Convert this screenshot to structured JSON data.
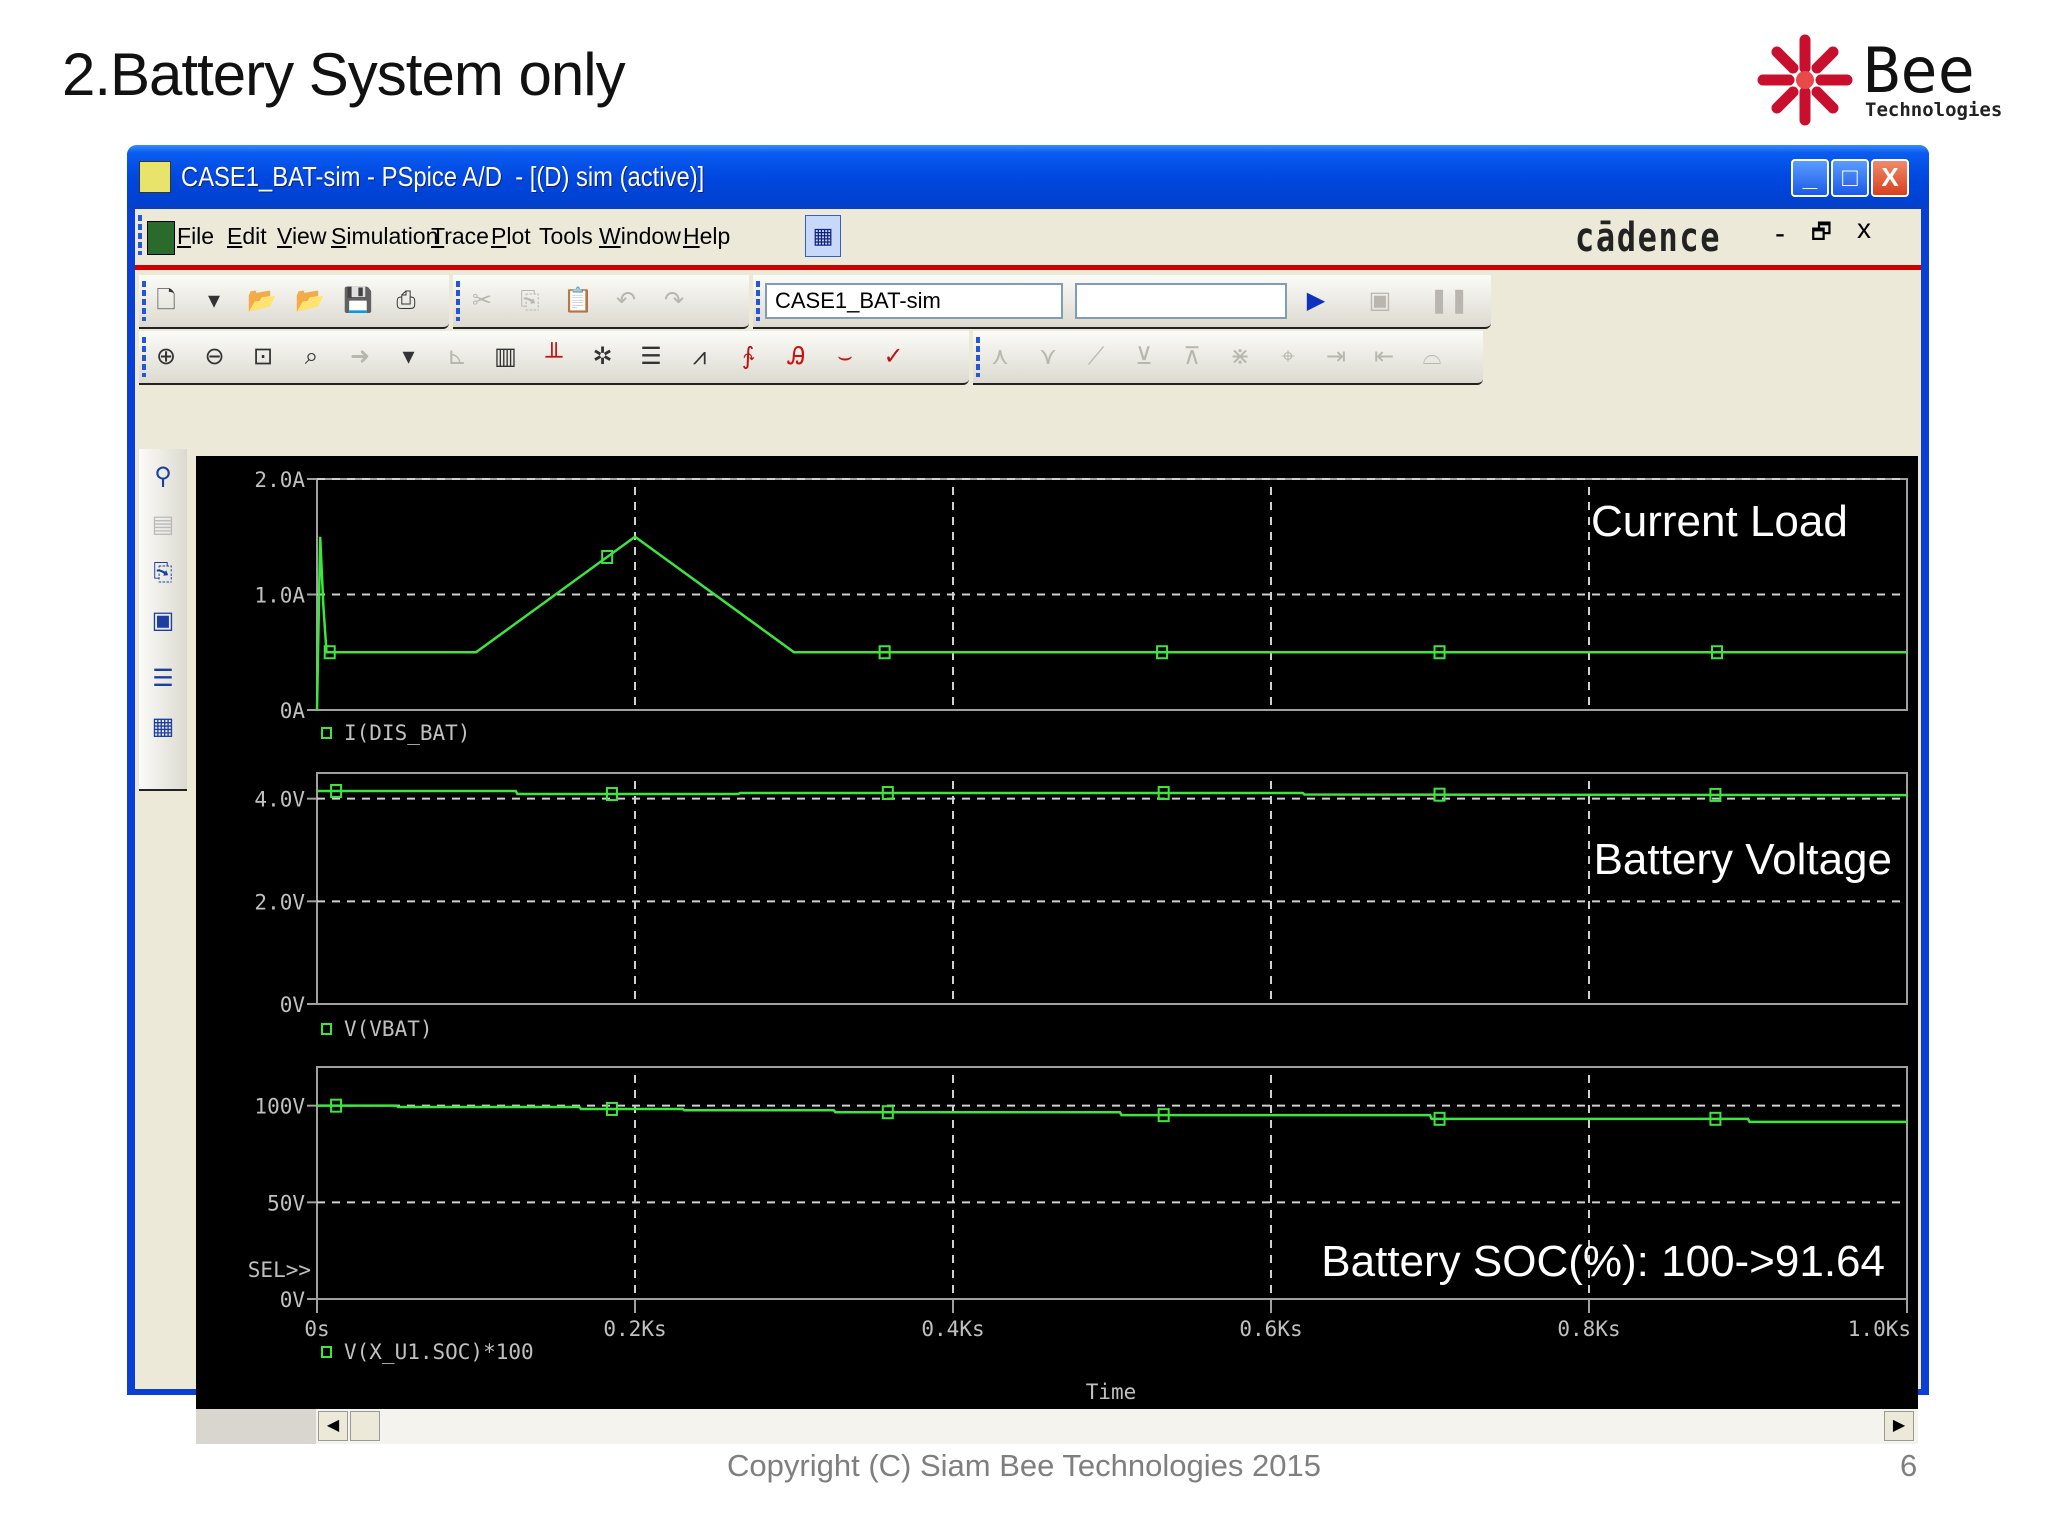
{
  "slide": {
    "title": "2.Battery System only",
    "logo_text": "Bee",
    "logo_subtext": "Technologies",
    "footer": "Copyright (C) Siam Bee Technologies 2015",
    "page_number": "6"
  },
  "window": {
    "title": "CASE1_BAT-sim - PSpice A/D  - [(D) sim (active)]",
    "controls": {
      "minimize": "_",
      "maximize": "□",
      "close": "X"
    },
    "brand": "cādence",
    "mdi_controls": {
      "minimize": "-",
      "restore": "🗗",
      "close": "x"
    }
  },
  "menu": [
    {
      "label": "File",
      "u": "F",
      "rest": "ile"
    },
    {
      "label": "Edit",
      "u": "E",
      "rest": "dit"
    },
    {
      "label": "View",
      "u": "V",
      "rest": "iew"
    },
    {
      "label": "Simulation",
      "u": "S",
      "rest": "imulation"
    },
    {
      "label": "Trace",
      "u": "T",
      "rest": "race"
    },
    {
      "label": "Plot",
      "u": "P",
      "rest": "lot"
    },
    {
      "label": "Tools",
      "u": "T",
      "rest": "ools",
      "pre": "",
      "mid": true
    },
    {
      "label": "Window",
      "u": "W",
      "rest": "indow"
    },
    {
      "label": "Help",
      "u": "H",
      "rest": "elp"
    }
  ],
  "toolbar": {
    "profile_combo": "CASE1_BAT-sim",
    "second_combo": "",
    "row1_icons": [
      "new-icon",
      "dropdown-arrow-icon",
      "open-icon",
      "open-folder-icon",
      "save-icon",
      "print-icon",
      "cut-icon",
      "copy-icon",
      "paste-icon",
      "undo-icon",
      "redo-icon"
    ],
    "row1_right_icons": [
      "run-icon",
      "pause-icon",
      "stop-icon"
    ],
    "row2_icons": [
      "zoom-in-icon",
      "zoom-out-icon",
      "zoom-area-icon",
      "zoom-fit-icon",
      "arrow-icon",
      "dropdown-arrow-icon",
      "axis-icon",
      "add-plot-icon",
      "fft-icon",
      "cursor-icon",
      "table-icon",
      "add-trace-icon",
      "eval-icon",
      "label-icon",
      "mark-icon",
      "toggle-cursor-icon"
    ],
    "row3_icons": [
      "peak-icon",
      "trough-icon",
      "slope-icon",
      "min-icon",
      "max-icon",
      "point-icon",
      "search-icon",
      "next-icon",
      "prev-icon",
      "mark-label-icon"
    ]
  },
  "left_toolbar_icons": [
    "probe-icon",
    "schematic-icon",
    "copy-plot-icon",
    "display-icon",
    "output-file-icon",
    "layout-icon"
  ],
  "colors": {
    "trace": "#3ce63c",
    "plot_bg": "#000000",
    "axis": "#c0c0c0",
    "titlebar": "#0048e0",
    "menu_accent": "#d00000"
  },
  "chart_data": [
    {
      "type": "line",
      "annotation": "Current Load",
      "legend": "I(DIS_BAT)",
      "xlim": [
        0,
        1.0
      ],
      "ylim": [
        0,
        2.0
      ],
      "yticks": [
        {
          "v": 2.0,
          "label": "2.0A"
        },
        {
          "v": 1.0,
          "label": "1.0A"
        },
        {
          "v": 0,
          "label": "0A"
        }
      ],
      "grid": true,
      "x": [
        0,
        0.002,
        0.004,
        0.006,
        0.01,
        0.1,
        0.2,
        0.3,
        1.0
      ],
      "y": [
        0,
        1.5,
        0.9,
        0.5,
        0.5,
        0.5,
        1.5,
        0.5,
        0.5
      ]
    },
    {
      "type": "line",
      "annotation": "Battery Voltage",
      "legend": "V(VBAT)",
      "xlim": [
        0,
        1.0
      ],
      "ylim": [
        0,
        4.5
      ],
      "yticks": [
        {
          "v": 4.0,
          "label": "4.0V"
        },
        {
          "v": 2.0,
          "label": "2.0V"
        },
        {
          "v": 0,
          "label": "0V"
        }
      ],
      "grid": true,
      "x": [
        0,
        0.125,
        0.126,
        0.265,
        0.266,
        0.62,
        0.621,
        1.0
      ],
      "y": [
        4.15,
        4.15,
        4.09,
        4.09,
        4.11,
        4.11,
        4.08,
        4.07
      ]
    },
    {
      "type": "line",
      "annotation": "Battery SOC(%): 100->91.64",
      "legend": "V(X_U1.SOC)*100",
      "sel_marker": "SEL>>",
      "xlim": [
        0,
        1.0
      ],
      "ylim": [
        0,
        120
      ],
      "yticks": [
        {
          "v": 100,
          "label": "100V"
        },
        {
          "v": 50,
          "label": "50V"
        },
        {
          "v": 0,
          "label": "0V"
        }
      ],
      "grid": true,
      "x": [
        0,
        0.05,
        0.051,
        0.165,
        0.166,
        0.23,
        0.231,
        0.325,
        0.326,
        0.505,
        0.506,
        0.7,
        0.701,
        0.9,
        0.901,
        1.0
      ],
      "y": [
        100,
        100,
        99.3,
        99.3,
        98.3,
        98.3,
        97.6,
        97.6,
        96.6,
        96.6,
        95.1,
        95.1,
        93.2,
        93.2,
        91.64,
        91.64
      ]
    }
  ],
  "x_axis": {
    "label": "Time",
    "ticks": [
      {
        "v": 0,
        "label": "0s"
      },
      {
        "v": 0.2,
        "label": "0.2Ks"
      },
      {
        "v": 0.4,
        "label": "0.4Ks"
      },
      {
        "v": 0.6,
        "label": "0.6Ks"
      },
      {
        "v": 0.8,
        "label": "0.8Ks"
      },
      {
        "v": 1.0,
        "label": "1.0Ks"
      }
    ]
  },
  "scrollbar": {
    "left": "◀",
    "right": "▶"
  }
}
